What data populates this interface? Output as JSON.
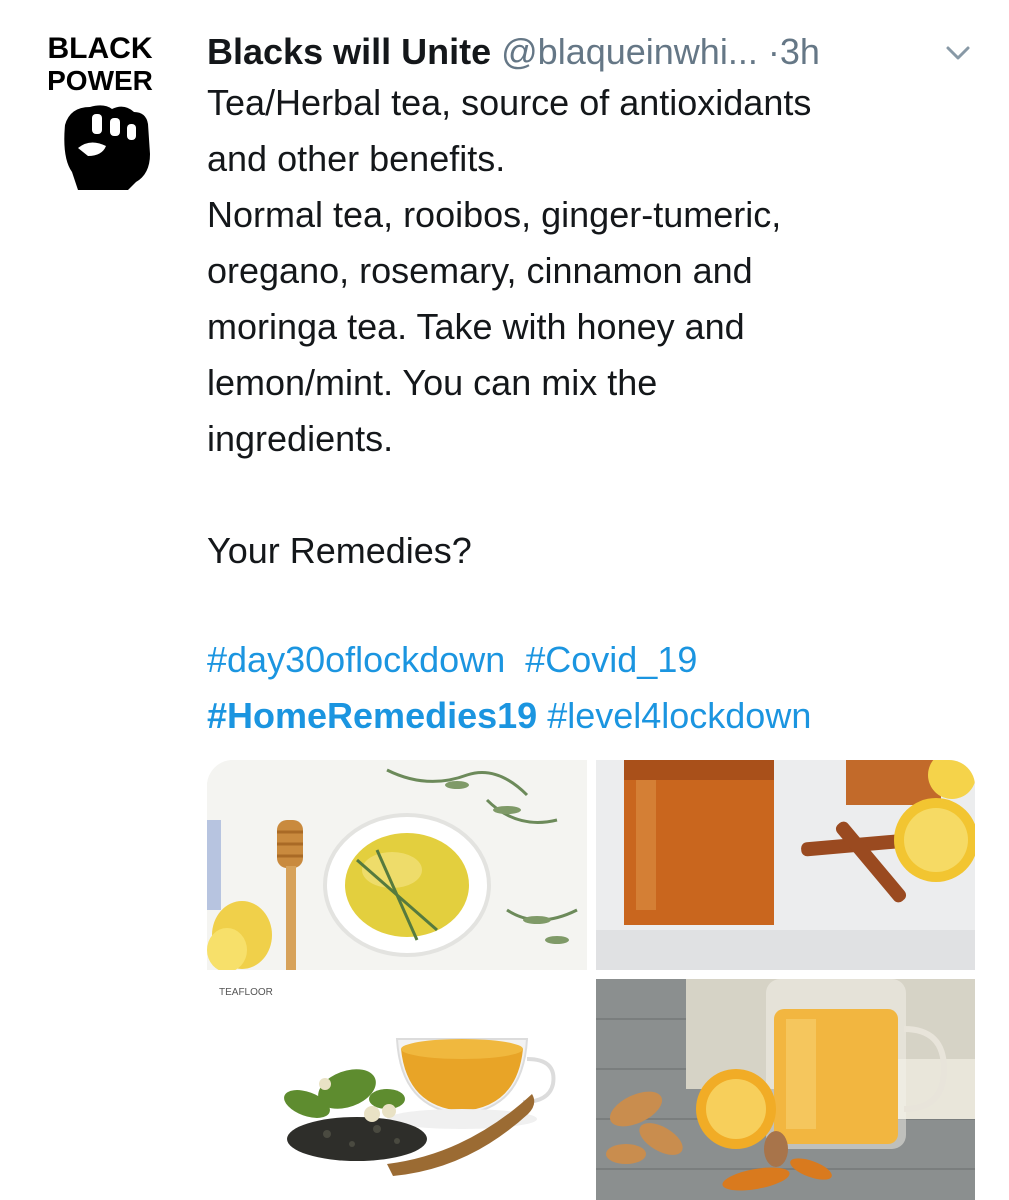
{
  "tweet": {
    "author_name": "Blacks will Unite",
    "handle": "@blaqueinwhi...",
    "separator": "·",
    "time": "3h",
    "avatar": {
      "text_top": "BLACK",
      "text_bottom": "POWER",
      "icon": "raised-fist-icon"
    },
    "lines": [
      "Tea/Herbal tea, source of antioxidants",
      "and other benefits.",
      "Normal tea, rooibos, ginger-tumeric,",
      "oregano, rosemary, cinnamon and",
      "moringa tea. Take with honey and",
      "lemon/mint. You can mix the",
      "ingredients."
    ],
    "question": "Your Remedies?",
    "hashtags": [
      "#day30oflockdown",
      "#Covid_19",
      "#HomeRemedies19",
      "#level4lockdown"
    ],
    "media": [
      {
        "icon": "herbal-tea-cup-photo"
      },
      {
        "icon": "rooibos-tea-jar-photo"
      },
      {
        "icon": "tea-cup-leaves-photo",
        "watermark": "TEAFLOOR"
      },
      {
        "icon": "ginger-turmeric-tea-photo"
      }
    ],
    "colors": {
      "link": "#1b95e0",
      "text": "#14171a",
      "muted": "#657786"
    }
  }
}
